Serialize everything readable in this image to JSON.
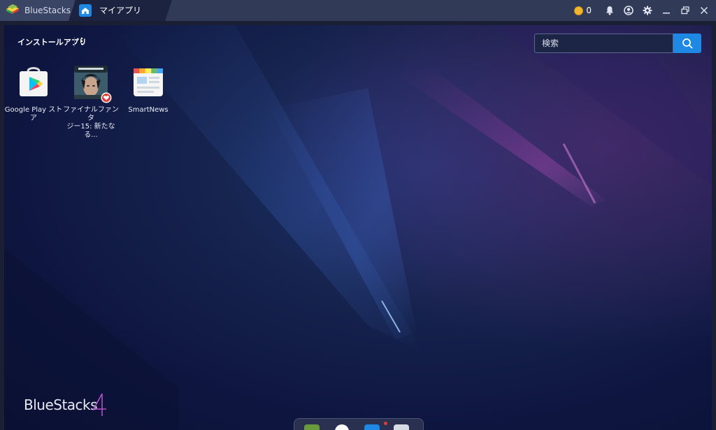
{
  "titlebar": {
    "app_name": "BlueStacks",
    "active_tab": "マイアプリ",
    "coin_count": "0",
    "icons": {
      "coin": "coin-icon",
      "notifications": "bell-icon",
      "account": "account-icon",
      "settings": "gear-icon",
      "minimize": "minimize-icon",
      "restore": "restore-icon",
      "close": "close-icon"
    }
  },
  "main": {
    "section_title": "インストールアプリ",
    "search": {
      "placeholder": "検索"
    },
    "apps": [
      {
        "label_line1": "Google Play スト",
        "label_line2": "ア",
        "icon": "google-play-icon"
      },
      {
        "label_line1": "ファイナルファンタ",
        "label_line2": "ジー15: 新たなる...",
        "icon": "final-fantasy-icon"
      },
      {
        "label_line1": "SmartNews",
        "label_line2": "",
        "icon": "smartnews-icon"
      }
    ],
    "brand": "BlueStacks"
  },
  "colors": {
    "accent": "#1e88e5",
    "titlebar": "#313a57",
    "background": "#0e1640"
  }
}
